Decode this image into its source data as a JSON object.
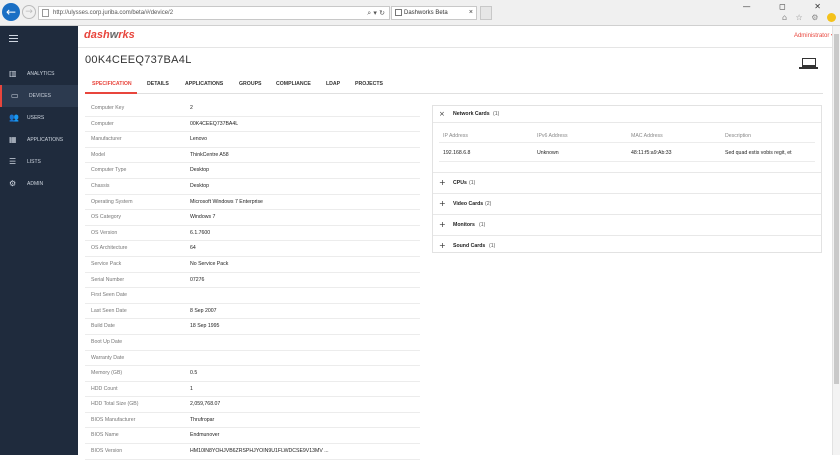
{
  "browser": {
    "url": "http://ulysses.corp.juriba.com/beta/#/device/2",
    "tab_title": "Dashworks Beta",
    "addr_tools": "⌕ ▾ ↻",
    "window_controls": "—  ◻  ✕",
    "toolbar_icons": "⌂ ☆ ⚙"
  },
  "sidebar": {
    "items": [
      {
        "label": "ANALYTICS",
        "icon": "chart-icon"
      },
      {
        "label": "DEVICES",
        "icon": "laptop-icon"
      },
      {
        "label": "USERS",
        "icon": "users-icon"
      },
      {
        "label": "APPLICATIONS",
        "icon": "grid-icon"
      },
      {
        "label": "LISTS",
        "icon": "list-icon"
      },
      {
        "label": "ADMIN",
        "icon": "gear-icon"
      }
    ]
  },
  "header": {
    "logo_dash": "dash",
    "logo_wo": "w",
    "logo_rest": "rks",
    "user": "Administrator ▾"
  },
  "device": {
    "title": "00K4CEEQ737BA4L"
  },
  "tabs": [
    "SPECIFICATION",
    "DETAILS",
    "APPLICATIONS",
    "GROUPS",
    "COMPLIANCE",
    "LDAP",
    "PROJECTS"
  ],
  "spec": [
    {
      "k": "Computer Key",
      "v": "2"
    },
    {
      "k": "Computer",
      "v": "00K4CEEQ737BA4L"
    },
    {
      "k": "Manufacturer",
      "v": "Lenovo"
    },
    {
      "k": "Model",
      "v": "ThinkCentre A58"
    },
    {
      "k": "Computer Type",
      "v": "Desktop"
    },
    {
      "k": "Chassis",
      "v": "Desktop"
    },
    {
      "k": "Operating System",
      "v": "Microsoft Windows 7 Enterprise"
    },
    {
      "k": "OS Category",
      "v": "Windows 7"
    },
    {
      "k": "OS Version",
      "v": "6.1.7600"
    },
    {
      "k": "OS Architecture",
      "v": "64"
    },
    {
      "k": "Service Pack",
      "v": "No Service Pack"
    },
    {
      "k": "Serial Number",
      "v": "07276"
    },
    {
      "k": "First Seen Date",
      "v": ""
    },
    {
      "k": "Last Seen Date",
      "v": "8 Sep 2007"
    },
    {
      "k": "Build Date",
      "v": "18 Sep 1995"
    },
    {
      "k": "Boot Up Date",
      "v": ""
    },
    {
      "k": "Warranty Date",
      "v": ""
    },
    {
      "k": "Memory (GB)",
      "v": "0.5"
    },
    {
      "k": "HDD Count",
      "v": "1"
    },
    {
      "k": "HDD Total Size (GB)",
      "v": "2,059,768.07"
    },
    {
      "k": "BIOS Manufacturer",
      "v": "Thrufropar"
    },
    {
      "k": "BIOS Name",
      "v": "Endmunover"
    },
    {
      "k": "BIOS Version",
      "v": "HM10IN8YOHJVB6ZRSPHJYOIN9U1FLWDCSE9V13MV ..."
    }
  ],
  "network": {
    "title": "Network Cards",
    "count": "(1)",
    "headers": [
      "IP Address",
      "IPv6 Address",
      "MAC Address",
      "Description"
    ],
    "row": [
      "192.168.6.8",
      "Unknown",
      "48:11:f5:a9:Ab:33",
      "Sed quad estis vobis regit, et"
    ]
  },
  "sections": [
    {
      "title": "CPUs",
      "count": "(1)"
    },
    {
      "title": "Video Cards",
      "count": "(2)"
    },
    {
      "title": "Monitors",
      "count": "(1)"
    },
    {
      "title": "Sound Cards",
      "count": "(1)"
    }
  ],
  "colors": {
    "accent": "#e8453c",
    "sidebar": "#1f2b3d"
  }
}
